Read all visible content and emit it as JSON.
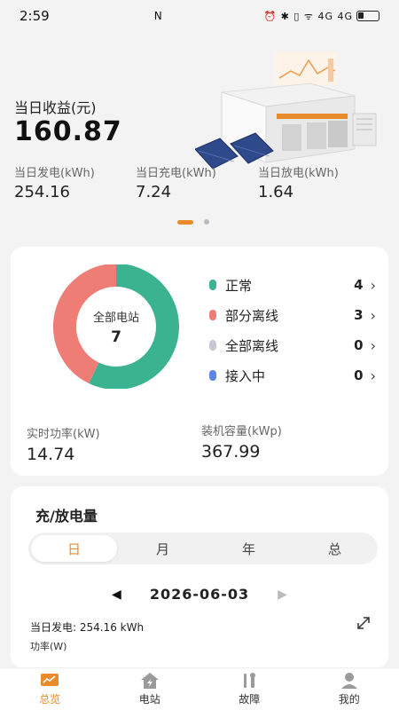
{
  "status_bar": {
    "time": "2:59",
    "nfc": "N",
    "indicators": "⏰ ✱ ▯ ᯤ 4G 4G"
  },
  "hero": {
    "today_income_label": "当日收益(元)",
    "today_income_value": "160.87",
    "stats": [
      {
        "label": "当日发电(kWh)",
        "value": "254.16"
      },
      {
        "label": "当日充电(kWh)",
        "value": "7.24"
      },
      {
        "label": "当日放电(kWh)",
        "value": "1.64"
      }
    ],
    "pager_active_color": "#e98b2a"
  },
  "station_card": {
    "donut_title": "全部电站",
    "donut_total": "7",
    "legend": [
      {
        "label": "正常",
        "count": "4",
        "color": "#3bb391"
      },
      {
        "label": "部分离线",
        "count": "3",
        "color": "#ee7d76"
      },
      {
        "label": "全部离线",
        "count": "0",
        "color": "#c6c9d2"
      },
      {
        "label": "接入中",
        "count": "0",
        "color": "#5b86e5"
      }
    ],
    "realtime_power_label": "实时功率(kW)",
    "realtime_power_value": "14.74",
    "capacity_label": "装机容量(kWp)",
    "capacity_value": "367.99"
  },
  "charge_card": {
    "title": "充/放电量",
    "tabs": [
      "日",
      "月",
      "年",
      "总"
    ],
    "active_tab": "日",
    "date": "2026-06-03",
    "today_gen_text": "当日发电: 254.16 kWh",
    "power_unit": "功率(W)"
  },
  "tabbar": {
    "items": [
      {
        "label": "总览",
        "icon": "overview-icon",
        "active": true
      },
      {
        "label": "电站",
        "icon": "station-icon",
        "active": false
      },
      {
        "label": "故障",
        "icon": "fault-icon",
        "active": false
      },
      {
        "label": "我的",
        "icon": "profile-icon",
        "active": false
      }
    ],
    "accent": "#e98b2a"
  }
}
